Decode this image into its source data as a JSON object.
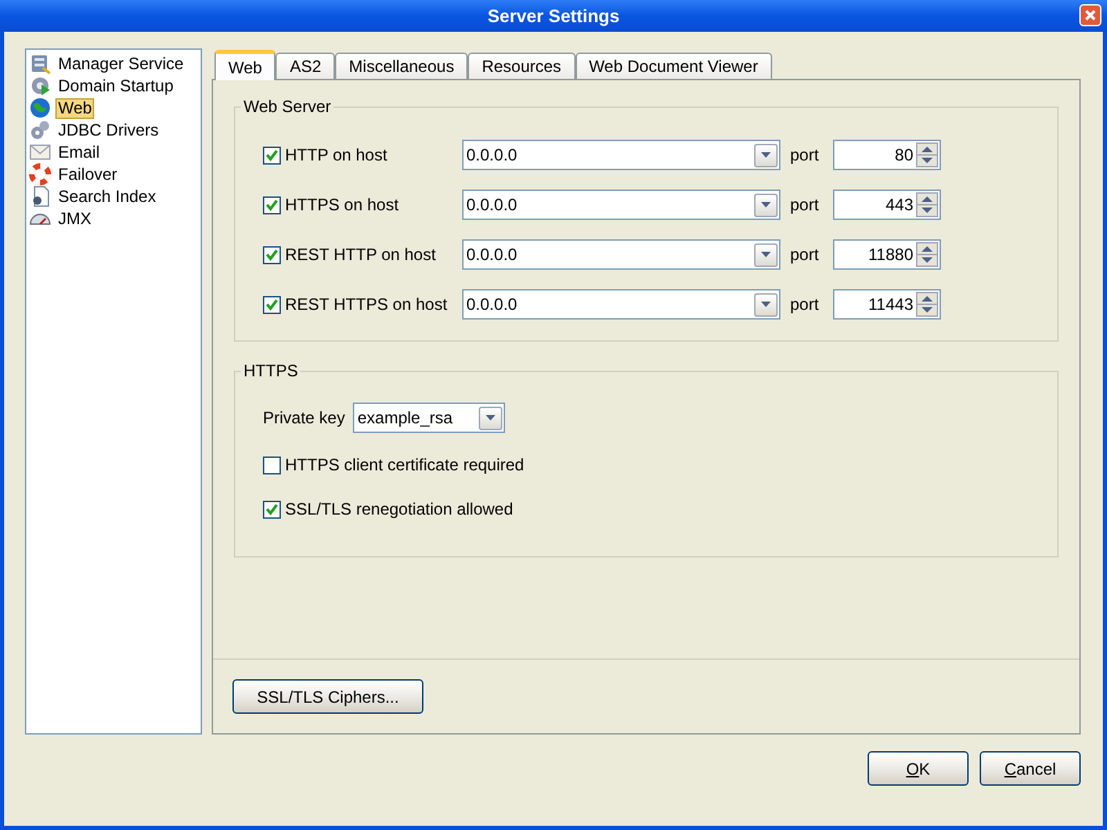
{
  "window": {
    "title": "Server Settings"
  },
  "sidebar": {
    "items": [
      {
        "label": "Manager Service",
        "selected": false
      },
      {
        "label": "Domain Startup",
        "selected": false
      },
      {
        "label": "Web",
        "selected": true
      },
      {
        "label": "JDBC Drivers",
        "selected": false
      },
      {
        "label": "Email",
        "selected": false
      },
      {
        "label": "Failover",
        "selected": false
      },
      {
        "label": "Search Index",
        "selected": false
      },
      {
        "label": "JMX",
        "selected": false
      }
    ]
  },
  "tabs": [
    {
      "label": "Web",
      "selected": true
    },
    {
      "label": "AS2",
      "selected": false
    },
    {
      "label": "Miscellaneous",
      "selected": false
    },
    {
      "label": "Resources",
      "selected": false
    },
    {
      "label": "Web Document Viewer",
      "selected": false
    }
  ],
  "web_server": {
    "title": "Web Server",
    "rows": [
      {
        "label": "HTTP on host",
        "checked": true,
        "host": "0.0.0.0",
        "port_label": "port",
        "port": "80"
      },
      {
        "label": "HTTPS on host",
        "checked": true,
        "host": "0.0.0.0",
        "port_label": "port",
        "port": "443"
      },
      {
        "label": "REST HTTP on host",
        "checked": true,
        "host": "0.0.0.0",
        "port_label": "port",
        "port": "11880"
      },
      {
        "label": "REST HTTPS on host",
        "checked": true,
        "host": "0.0.0.0",
        "port_label": "port",
        "port": "11443"
      }
    ]
  },
  "https": {
    "title": "HTTPS",
    "private_key_label": "Private key",
    "private_key": "example_rsa",
    "options": [
      {
        "label": "HTTPS client certificate required",
        "checked": false
      },
      {
        "label": "SSL/TLS renegotiation allowed",
        "checked": true
      }
    ]
  },
  "ciphers_button": "SSL/TLS Ciphers...",
  "buttons": [
    {
      "label": "OK",
      "mnemonic_first": true
    },
    {
      "label": "Cancel",
      "mnemonic_first": true
    }
  ]
}
